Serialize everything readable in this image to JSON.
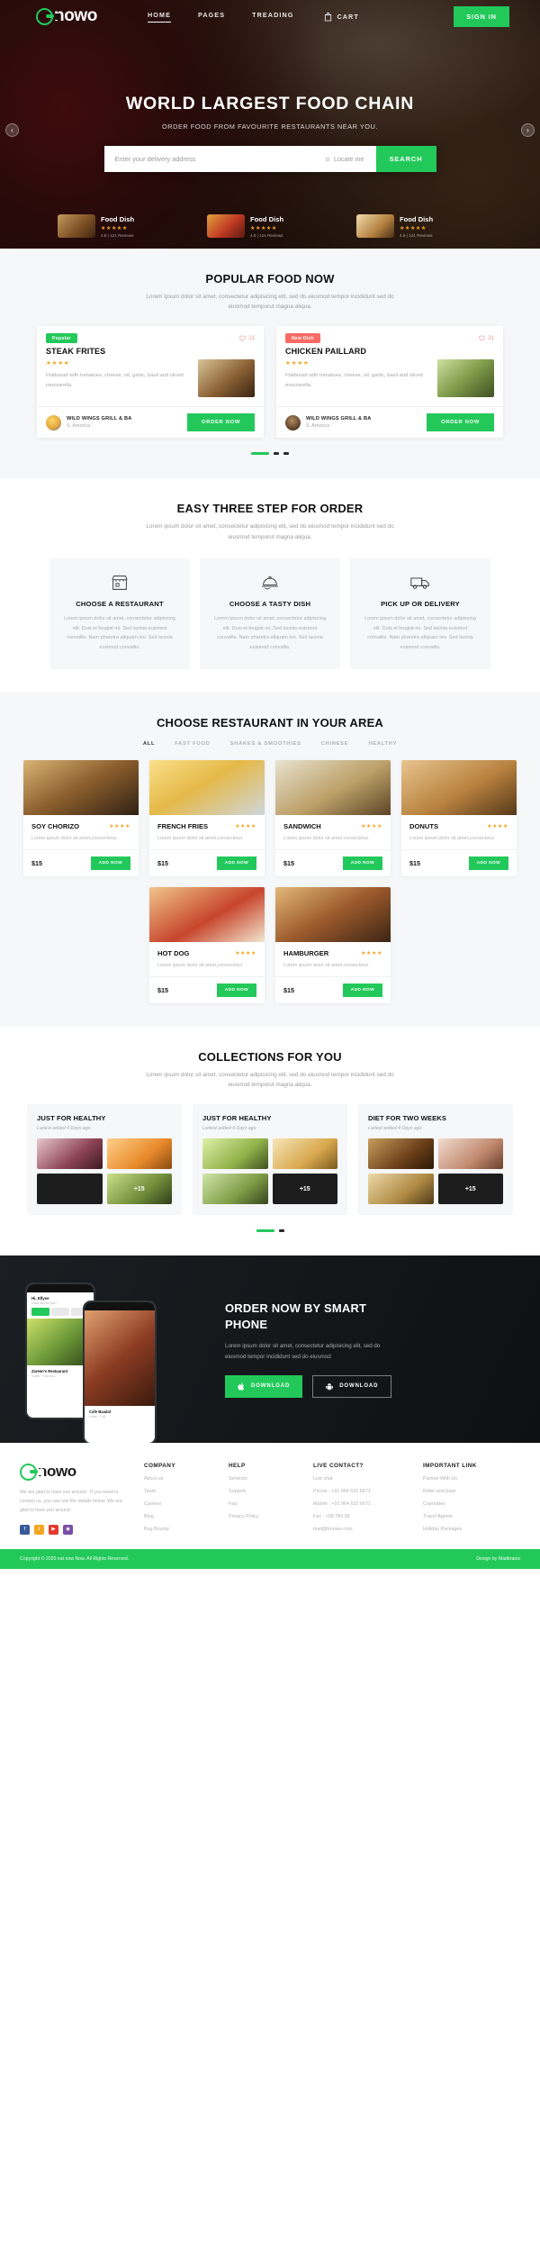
{
  "brand": {
    "name": "nowo",
    "logo_icon": "enowo-circle-logo"
  },
  "nav": {
    "links": [
      {
        "label": "HOME",
        "active": true
      },
      {
        "label": "PAGES",
        "active": false
      },
      {
        "label": "TREADING",
        "active": false
      }
    ],
    "cart_label": "CART",
    "cart_icon": "shopping-bag-icon",
    "signin_label": "SIGN IN"
  },
  "hero": {
    "title": "WORLD LARGEST FOOD CHAIN",
    "subtitle": "ORDER FOOD FROM FAVOURITE RESTAURANTS NEAR YOU.",
    "search_placeholder": "Enter your delivery address",
    "locate_label": "Locate me",
    "locate_icon": "crosshair-icon",
    "search_button": "SEARCH",
    "prev_icon": "chevron-left-icon",
    "next_icon": "chevron-right-icon",
    "dishes": [
      {
        "name": "Food Dish",
        "stars": "★★★★★",
        "meta": "4.8 | 121 Reviews"
      },
      {
        "name": "Food Dish",
        "stars": "★★★★★",
        "meta": "4.8 | 121 Reviews"
      },
      {
        "name": "Food Dish",
        "stars": "★★★★★",
        "meta": "4.8 | 121 Reviews"
      }
    ]
  },
  "popular": {
    "title": "POPULAR FOOD NOW",
    "desc": "Lorem ipsum dolor sit amet, consectetur adipisicing elit, sed do eiusmod tempor incididunt sed do eiusmod temporut magna aliqua.",
    "cards": [
      {
        "tag": "Popular",
        "fav_count": "21",
        "fav_icon": "heart-icon",
        "name": "STEAK FRITES",
        "stars": "★★★★",
        "half": "★",
        "text": "Flatbread with tomatoes, cheese, oil, garlic, basil and sliced mozzarella.",
        "restaurant": "WILD WINGS GRILL & BA",
        "location": "S. America",
        "order_label": "ORDER NOW"
      },
      {
        "tag": "New Dish",
        "fav_count": "21",
        "fav_icon": "heart-icon",
        "name": "CHICKEN PAILLARD",
        "stars": "★★★★",
        "half": "★",
        "text": "Flatbread with tomatoes, cheese, oil, garlic, basil and sliced mozzarella.",
        "restaurant": "WILD WINGS GRILL & BA",
        "location": "S. America",
        "order_label": "ORDER NOW"
      }
    ]
  },
  "steps": {
    "title": "EASY THREE STEP FOR ORDER",
    "desc": "Lorem ipsum dolor sit amet, consectetur adipisicing elit, sed do eiusmod tempor incididunt sed do eiusmod temporut magna aliqua.",
    "items": [
      {
        "icon": "storefront-icon",
        "name": "CHOOSE A RESTAURANT",
        "text": "Lorem ipsum dolor sit amet, consectetur adipiscing elit. Duis et feugiat mi. Sed lacinia euismod convallis. Nam pharetra aliquam leo. Sed lacinia euismod convallis."
      },
      {
        "icon": "cloche-dish-icon",
        "name": "CHOOSE A TASTY DISH",
        "text": "Lorem ipsum dolor sit amet, consectetur adipiscing elit. Duis et feugiat mi. Sed lacinia euismod convallis. Nam pharetra aliquam leo. Sed lacinia euismod convallis."
      },
      {
        "icon": "delivery-truck-icon",
        "name": "PICK UP OR DELIVERY",
        "text": "Lorem ipsum dolor sit amet, consectetur adipiscing elit. Duis et feugiat mi. Sed lacinia euismod convallis. Nam pharetra aliquam leo. Sed lacinia euismod convallis."
      }
    ]
  },
  "restaurants": {
    "title": "CHOOSE RESTAURANT IN YOUR AREA",
    "tabs": [
      {
        "label": "ALL",
        "active": true
      },
      {
        "label": "FAST FOOD",
        "active": false
      },
      {
        "label": "SHAKES & SMOOTHIES",
        "active": false
      },
      {
        "label": "CHINESE",
        "active": false
      },
      {
        "label": "HEALTHY",
        "active": false
      }
    ],
    "add_label": "ADD NOW",
    "cards": [
      {
        "name": "SOY CHORIZO",
        "stars": "★★★★",
        "half": "★",
        "desc": "Lorem ipsum dolor sit amet,consectetur",
        "price": "$15"
      },
      {
        "name": "FRENCH FRIES",
        "stars": "★★★★",
        "half": "★",
        "desc": "Lorem ipsum dolor sit amet,consectetur",
        "price": "$15"
      },
      {
        "name": "SANDWICH",
        "stars": "★★★★",
        "half": "★",
        "desc": "Lorem ipsum dolor sit amet,consectetur",
        "price": "$15"
      },
      {
        "name": "DONUTS",
        "stars": "★★★★",
        "half": "★",
        "desc": "Lorem ipsum dolor sit amet,consectetur",
        "price": "$15"
      },
      {
        "name": "HOT DOG",
        "stars": "★★★★",
        "half": "★",
        "desc": "Lorem ipsum dolor sit amet,consectetur",
        "price": "$15"
      },
      {
        "name": "HAMBURGER",
        "stars": "★★★★",
        "half": "★",
        "desc": "Lorem ipsum dolor sit amet,consectetur",
        "price": "$15"
      }
    ]
  },
  "collections": {
    "title": "COLLECTIONS FOR YOU",
    "desc": "Lorem ipsum dolor sit amet, consectetur adipisicing elit, sed do eiusmod tempor incididunt sed do eiusmod temporut magna aliqua.",
    "cards": [
      {
        "title": "JUST FOR HEALTHY",
        "sub": "Lartest added 4 Days ago",
        "more": "+15"
      },
      {
        "title": "JUST FOR HEALTHY",
        "sub": "Lartest added 4 Days ago",
        "more": "+15"
      },
      {
        "title": "DIET FOR TWO WEEKS",
        "sub": "Lartest added 4 Days ago",
        "more": "+15"
      }
    ]
  },
  "promo": {
    "title": "ORDER NOW BY SMART PHONE",
    "desc": "Lorem ipsum dolor sit amet, consectetur adipisicing elit, sed do eiusmod tempor incididunt sed do eiusmod",
    "btn_apple": "DOWNLOAD",
    "btn_android": "DOWNLOAD",
    "apple_icon": "apple-icon",
    "android_icon": "android-icon",
    "phone_back": {
      "greeting": "Hi, Ellyse",
      "sub": "Good day for you?",
      "caption": "Zareen's Restaurant",
      "caption2": "Indian . Fast food"
    },
    "phone_front": {
      "caption": "Cafe Baadal",
      "caption2": "Indian . Grill"
    }
  },
  "footer": {
    "brand": "nowo",
    "about": "We are glad to have you around . If you need to contact us, you can use the details below. We are glad to have you around.",
    "social": [
      {
        "icon": "facebook-icon",
        "glyph": "f"
      },
      {
        "icon": "twitter-icon",
        "glyph": "t"
      },
      {
        "icon": "youtube-icon",
        "glyph": "▶"
      },
      {
        "icon": "instagram-icon",
        "glyph": "◉"
      }
    ],
    "columns": [
      {
        "head": "COMPANY",
        "links": [
          "About us",
          "Team",
          "Careers",
          "Blog",
          "Bug Bounty"
        ]
      },
      {
        "head": "HELP",
        "links": [
          "Services",
          "Support",
          "Faq",
          "Privacy Policy"
        ]
      },
      {
        "head": "LIVE CONTACT?",
        "links": [
          "Live chat",
          "Phone : +91 964 632 6671",
          "Mobile : +91 964 632 6671",
          "Fax : +58 784 58",
          "mail@Enowo.com"
        ]
      },
      {
        "head": "IMPORTANT LINK",
        "links": [
          "Partner With Us",
          "Refer and Earn",
          "Coporates",
          "Travel Agents",
          "Holiday Packages"
        ]
      }
    ],
    "copyright": "Copyright © 2020 eat now Now. All Rights Reserved.",
    "design_by": "Design by Madbrains"
  },
  "colors": {
    "accent": "#22c95a",
    "star": "#f5a623",
    "new_tag": "#fa6a64"
  }
}
